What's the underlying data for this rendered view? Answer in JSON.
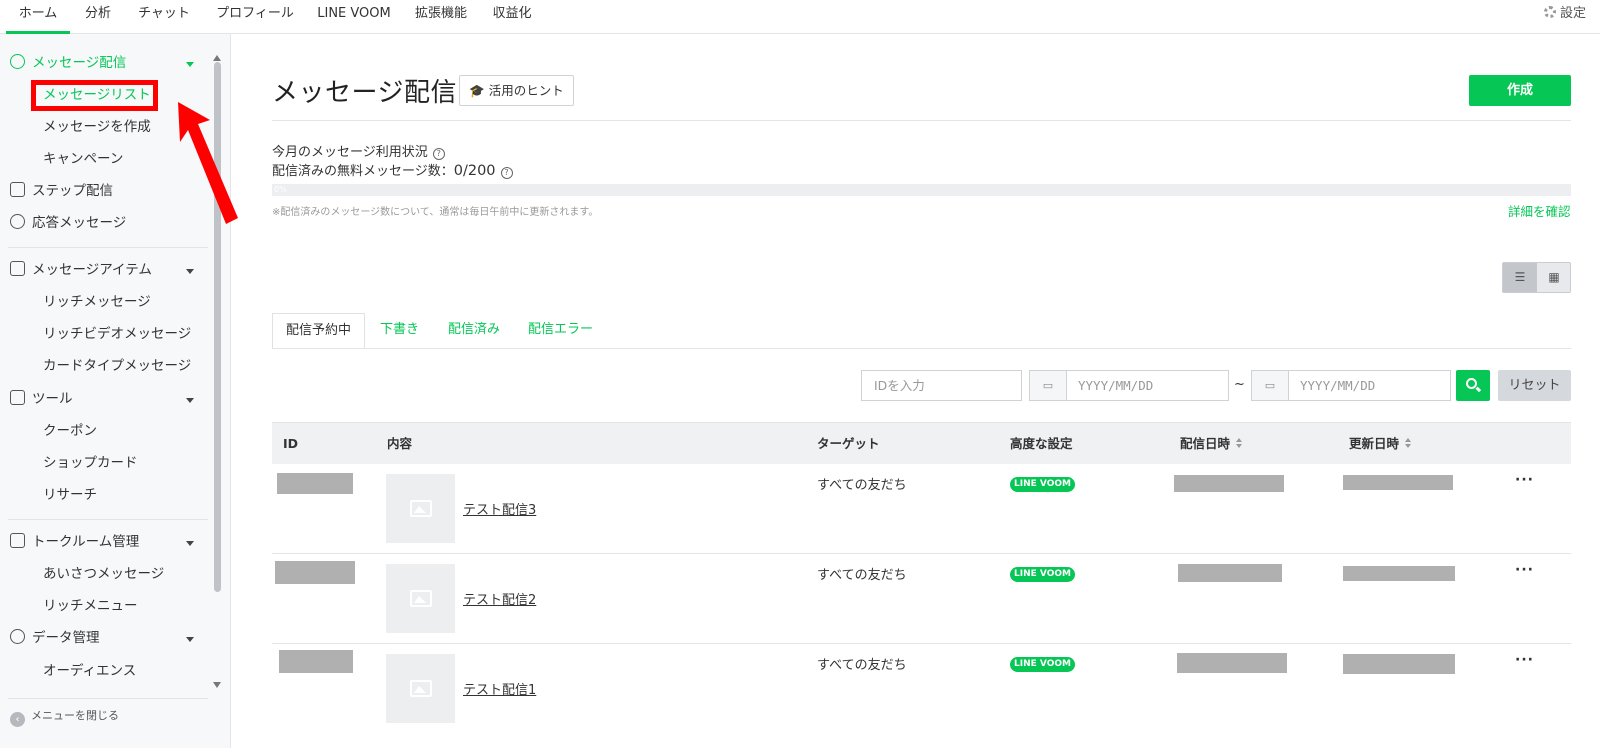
{
  "topnav": {
    "tabs": [
      "ホーム",
      "分析",
      "チャット",
      "プロフィール",
      "LINE VOOM",
      "拡張機能",
      "収益化"
    ],
    "settings": "設定"
  },
  "sidebar": {
    "messages": "メッセージ配信",
    "message_list": "メッセージリスト",
    "create_message": "メッセージを作成",
    "campaign": "キャンペーン",
    "step": "ステップ配信",
    "response": "応答メッセージ",
    "items": "メッセージアイテム",
    "rich_message": "リッチメッセージ",
    "rich_video": "リッチビデオメッセージ",
    "card_type": "カードタイプメッセージ",
    "tools": "ツール",
    "coupon": "クーポン",
    "shop_card": "ショップカード",
    "research": "リサーチ",
    "talkroom": "トークルーム管理",
    "greeting": "あいさつメッセージ",
    "rich_menu": "リッチメニュー",
    "data": "データ管理",
    "audience": "オーディエンス",
    "close_menu": "メニューを閉じる"
  },
  "main": {
    "title": "メッセージ配信",
    "hint": "活用のヒント",
    "create": "作成",
    "usage_title": "今月のメッセージ利用状況",
    "usage_label": "配信済みの無料メッセージ数：",
    "usage_value": "0/200",
    "progress": 0,
    "progress_label": "0%",
    "note": "※配信済みのメッセージ数について、通常は毎日午前中に更新されます。",
    "detail": "詳細を確認",
    "tabs": [
      "配信予約中",
      "下書き",
      "配信済み",
      "配信エラー"
    ],
    "id_placeholder": "IDを入力",
    "date_placeholder": "YYYY/MM/DD",
    "tilde": "~",
    "reset": "リセット",
    "columns": [
      "ID",
      "内容",
      "ターゲット",
      "高度な設定",
      "配信日時",
      "更新日時"
    ],
    "rows": [
      {
        "title": "テスト配信3",
        "target": "すべての友だち",
        "badge": "LINE VOOM"
      },
      {
        "title": "テスト配信2",
        "target": "すべての友だち",
        "badge": "LINE VOOM"
      },
      {
        "title": "テスト配信1",
        "target": "すべての友だち",
        "badge": "LINE VOOM"
      }
    ],
    "more": "···"
  },
  "colors": {
    "accent": "#06c755",
    "highlight": "#ff0000"
  }
}
